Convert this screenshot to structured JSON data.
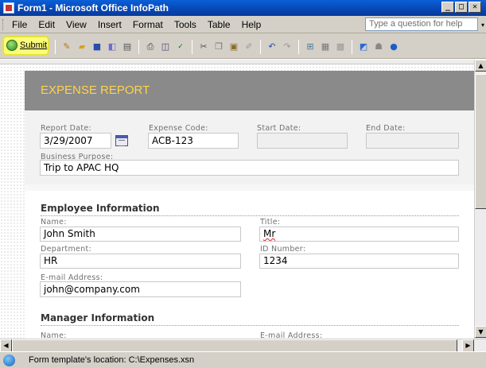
{
  "window": {
    "title": "Form1 - Microsoft Office InfoPath",
    "minimize": "_",
    "maximize": "□",
    "close": "✕"
  },
  "menu": {
    "items": [
      "File",
      "Edit",
      "View",
      "Insert",
      "Format",
      "Tools",
      "Table",
      "Help"
    ],
    "ask_placeholder": "Type a question for help"
  },
  "toolbar": {
    "submit_label": "Submit",
    "icons": [
      "design-icon",
      "open-icon",
      "save-icon",
      "export-icon",
      "print-preview-icon",
      "print-icon",
      "preview-icon",
      "spelling-icon",
      "cut-icon",
      "copy-icon",
      "paste-icon",
      "format-painter-icon",
      "undo-icon",
      "redo-icon",
      "insert-table-icon",
      "table-icon",
      "table2-icon",
      "chart-icon",
      "research-icon",
      "help-icon"
    ],
    "highlight_color": "#fbfb7a"
  },
  "form": {
    "title": "EXPENSE REPORT",
    "report_date_label": "Report Date:",
    "report_date_value": "3/29/2007",
    "expense_code_label": "Expense Code:",
    "expense_code_value": "ACB-123",
    "start_date_label": "Start Date:",
    "start_date_value": "",
    "end_date_label": "End Date:",
    "end_date_value": "",
    "business_purpose_label": "Business Purpose:",
    "business_purpose_value": "Trip to APAC HQ",
    "employee_section": "Employee Information",
    "name_label": "Name:",
    "name_value": "John Smith",
    "title_label": "Title:",
    "title_value": "Mr",
    "department_label": "Department:",
    "department_value": "HR",
    "id_label": "ID Number:",
    "id_value": "1234",
    "email_label": "E-mail Address:",
    "email_value": "john@company.com",
    "manager_section": "Manager Information",
    "manager_name_label": "Name:",
    "manager_email_label": "E-mail Address:",
    "header_color": "#8a8a8a",
    "title_color": "#ffd24a"
  },
  "status": {
    "text": "Form template's location: C:\\Expenses.xsn"
  }
}
